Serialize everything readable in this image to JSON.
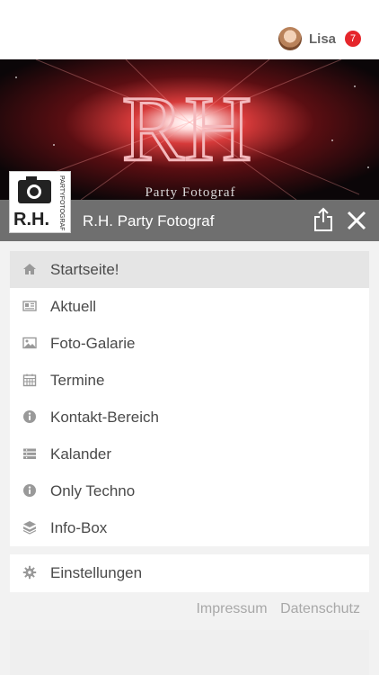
{
  "user": {
    "name": "Lisa",
    "notifications": "7"
  },
  "banner": {
    "monogram": "RH",
    "tagline": "Party Fotograf"
  },
  "logo": {
    "initials": "R.H.",
    "side_text": "PARTYFOTOGRAF"
  },
  "page": {
    "title": "R.H. Party Fotograf"
  },
  "menu": {
    "items": [
      {
        "label": "Startseite!",
        "icon": "home-icon"
      },
      {
        "label": "Aktuell",
        "icon": "newspaper-icon"
      },
      {
        "label": "Foto-Galarie",
        "icon": "image-icon"
      },
      {
        "label": "Termine",
        "icon": "calendar-icon"
      },
      {
        "label": "Kontakt-Bereich",
        "icon": "info-icon"
      },
      {
        "label": "Kalander",
        "icon": "list-icon"
      },
      {
        "label": "Only Techno",
        "icon": "info-icon"
      },
      {
        "label": "Info-Box",
        "icon": "box-icon"
      }
    ]
  },
  "settings": {
    "label": "Einstellungen",
    "icon": "gear-icon"
  },
  "footer": {
    "impressum": "Impressum",
    "datenschutz": "Datenschutz"
  },
  "colors": {
    "badge": "#e5262b",
    "titlebar": "#6f6f6f",
    "active_item": "#e5e5e5"
  }
}
